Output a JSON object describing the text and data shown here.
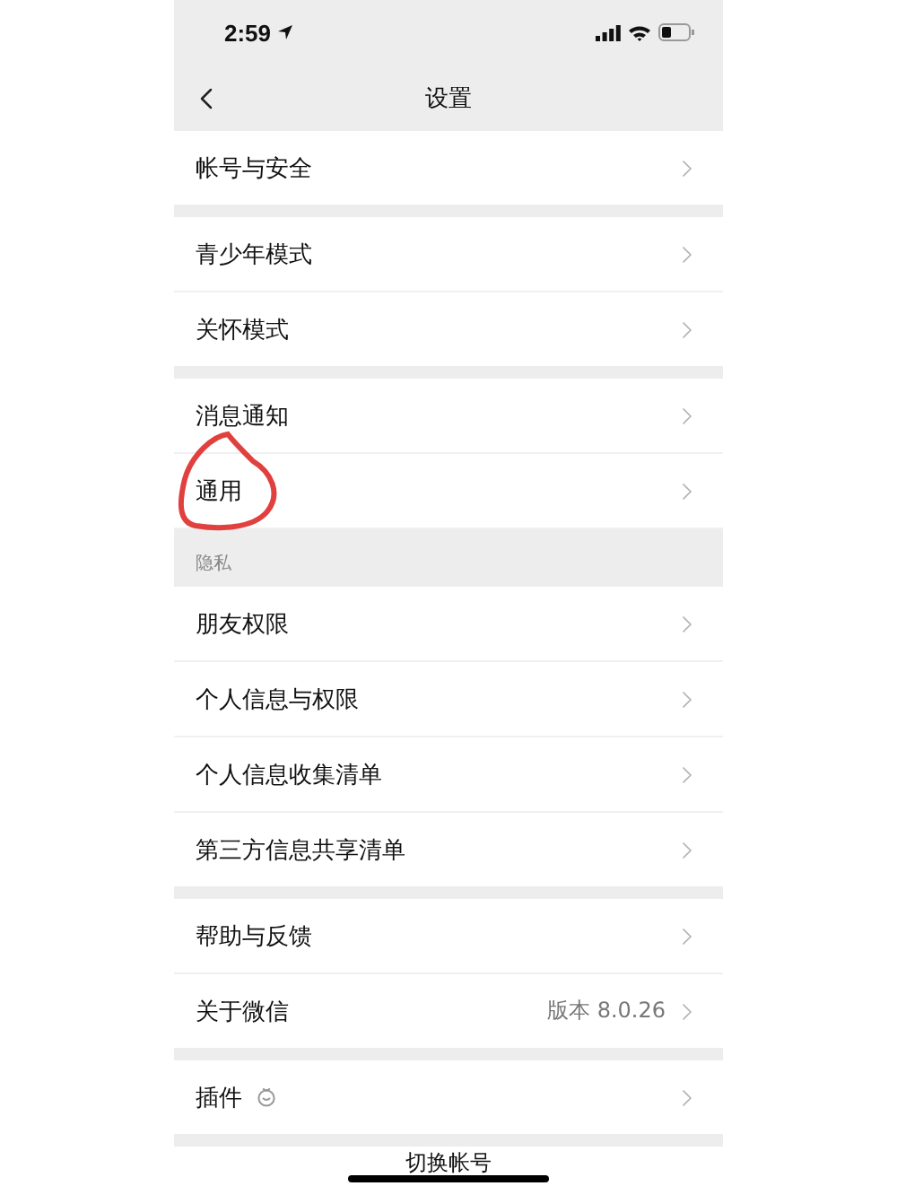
{
  "status_bar": {
    "time": "2:59"
  },
  "nav": {
    "title": "设置"
  },
  "sections": [
    {
      "items": [
        {
          "label": "帐号与安全",
          "circled": false
        }
      ]
    },
    {
      "items": [
        {
          "label": "青少年模式",
          "circled": false
        },
        {
          "label": "关怀模式",
          "circled": false
        }
      ]
    },
    {
      "items": [
        {
          "label": "消息通知",
          "circled": false
        },
        {
          "label": "通用",
          "circled": true
        }
      ]
    },
    {
      "header": "隐私",
      "items": [
        {
          "label": "朋友权限",
          "circled": false
        },
        {
          "label": "个人信息与权限",
          "circled": false
        },
        {
          "label": "个人信息收集清单",
          "circled": false
        },
        {
          "label": "第三方信息共享清单",
          "circled": false
        }
      ]
    },
    {
      "items": [
        {
          "label": "帮助与反馈",
          "circled": false
        },
        {
          "label": "关于微信",
          "value": "版本 8.0.26",
          "circled": false
        }
      ]
    },
    {
      "items": [
        {
          "label": "插件",
          "kind": "with-icon",
          "circled": false
        }
      ]
    }
  ],
  "footer": {
    "button": "切换帐号"
  }
}
